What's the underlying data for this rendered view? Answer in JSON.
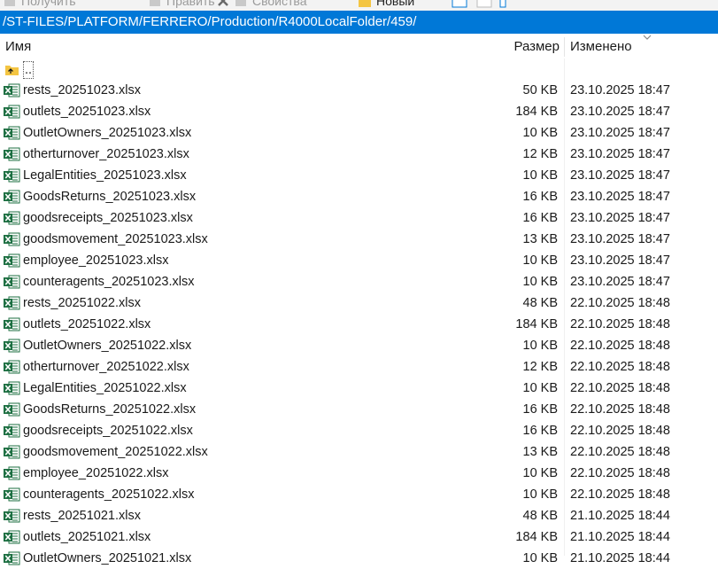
{
  "toolbar": {
    "items": [
      {
        "label": "Получить",
        "icon": "download-icon"
      },
      {
        "label": "Править",
        "icon": "edit-icon"
      },
      {
        "label": "Свойства",
        "icon": "properties-icon"
      },
      {
        "label": "Новый",
        "icon": "new-folder-icon"
      }
    ]
  },
  "path": "/ST-FILES/PLATFORM/FERRERO/Production/R4000LocalFolder/459/",
  "columns": {
    "name": "Имя",
    "size": "Размер",
    "modified": "Изменено"
  },
  "parent": {
    "name": ".."
  },
  "files": [
    {
      "name": "rests_20251023.xlsx",
      "size": "50 KB",
      "modified": "23.10.2025 18:47"
    },
    {
      "name": "outlets_20251023.xlsx",
      "size": "184 KB",
      "modified": "23.10.2025 18:47"
    },
    {
      "name": "OutletOwners_20251023.xlsx",
      "size": "10 KB",
      "modified": "23.10.2025 18:47"
    },
    {
      "name": "otherturnover_20251023.xlsx",
      "size": "12 KB",
      "modified": "23.10.2025 18:47"
    },
    {
      "name": "LegalEntities_20251023.xlsx",
      "size": "10 KB",
      "modified": "23.10.2025 18:47"
    },
    {
      "name": "GoodsReturns_20251023.xlsx",
      "size": "16 KB",
      "modified": "23.10.2025 18:47"
    },
    {
      "name": "goodsreceipts_20251023.xlsx",
      "size": "16 KB",
      "modified": "23.10.2025 18:47"
    },
    {
      "name": "goodsmovement_20251023.xlsx",
      "size": "13 KB",
      "modified": "23.10.2025 18:47"
    },
    {
      "name": "employee_20251023.xlsx",
      "size": "10 KB",
      "modified": "23.10.2025 18:47"
    },
    {
      "name": "counteragents_20251023.xlsx",
      "size": "10 KB",
      "modified": "23.10.2025 18:47"
    },
    {
      "name": "rests_20251022.xlsx",
      "size": "48 KB",
      "modified": "22.10.2025 18:48"
    },
    {
      "name": "outlets_20251022.xlsx",
      "size": "184 KB",
      "modified": "22.10.2025 18:48"
    },
    {
      "name": "OutletOwners_20251022.xlsx",
      "size": "10 KB",
      "modified": "22.10.2025 18:48"
    },
    {
      "name": "otherturnover_20251022.xlsx",
      "size": "12 KB",
      "modified": "22.10.2025 18:48"
    },
    {
      "name": "LegalEntities_20251022.xlsx",
      "size": "10 KB",
      "modified": "22.10.2025 18:48"
    },
    {
      "name": "GoodsReturns_20251022.xlsx",
      "size": "16 KB",
      "modified": "22.10.2025 18:48"
    },
    {
      "name": "goodsreceipts_20251022.xlsx",
      "size": "16 KB",
      "modified": "22.10.2025 18:48"
    },
    {
      "name": "goodsmovement_20251022.xlsx",
      "size": "13 KB",
      "modified": "22.10.2025 18:48"
    },
    {
      "name": "employee_20251022.xlsx",
      "size": "10 KB",
      "modified": "22.10.2025 18:48"
    },
    {
      "name": "counteragents_20251022.xlsx",
      "size": "10 KB",
      "modified": "22.10.2025 18:48"
    },
    {
      "name": "rests_20251021.xlsx",
      "size": "48 KB",
      "modified": "21.10.2025 18:44"
    },
    {
      "name": "outlets_20251021.xlsx",
      "size": "184 KB",
      "modified": "21.10.2025 18:44"
    },
    {
      "name": "OutletOwners_20251021.xlsx",
      "size": "10 KB",
      "modified": "21.10.2025 18:44"
    }
  ],
  "colors": {
    "accent": "#0078d7",
    "excel_green": "#1d6f42"
  }
}
